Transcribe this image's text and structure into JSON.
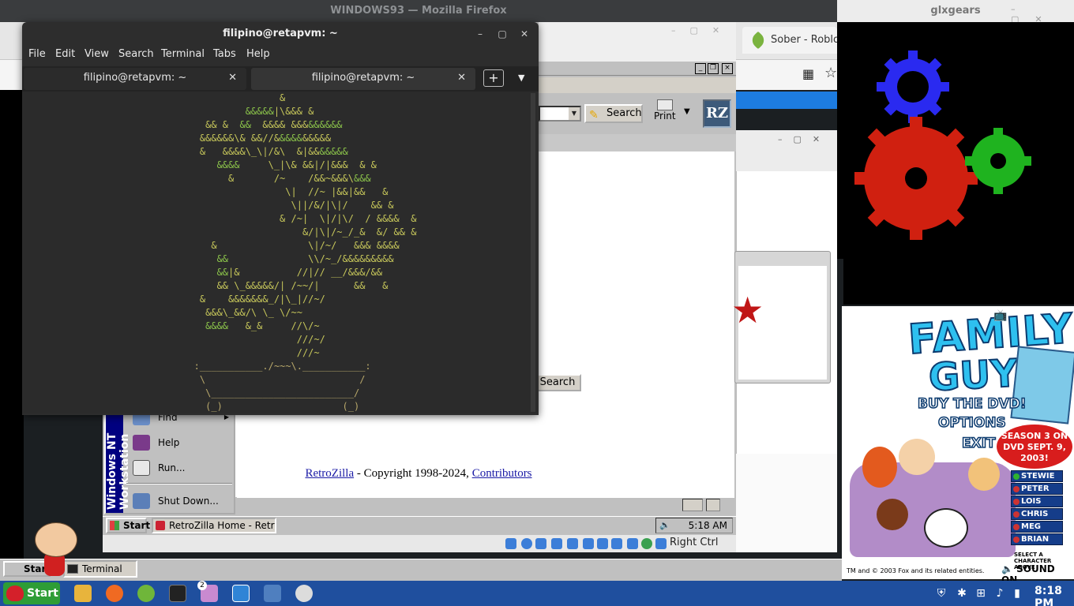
{
  "firefox": {
    "title": "WINDOWS93 — Mozilla Firefox",
    "tab_right_label": "Sober - Roblo"
  },
  "retrozilla": {
    "search_button": "Search",
    "print_label": "Print",
    "logo_text": "RZ",
    "content_search_button": "Search",
    "footer_link": "RetroZilla",
    "footer_text": " - Copyright 1998-2024, ",
    "footer_contributors": "Contributors"
  },
  "nt": {
    "banner": "Windows NT Workstation",
    "start_menu": [
      {
        "label": "Find",
        "icon": "find-icon"
      },
      {
        "label": "Help",
        "icon": "help-icon"
      },
      {
        "label": "Run...",
        "icon": "run-icon"
      },
      {
        "label": "Shut Down...",
        "icon": "shutdown-icon"
      }
    ],
    "start": "Start",
    "task": "RetroZilla Home - RetroZilla",
    "clock": "5:18 AM"
  },
  "vbox": {
    "host_key": "Right Ctrl"
  },
  "terminal": {
    "title": "filipino@retapvm: ~",
    "menu": [
      "File",
      "Edit",
      "View",
      "Search",
      "Terminal",
      "Tabs",
      "Help"
    ],
    "tabs": [
      "filipino@retapvm: ~",
      "filipino@retapvm: ~"
    ]
  },
  "glxgears": {
    "title": "glxgears"
  },
  "family_guy": {
    "title_line1": "FAMILY",
    "title_line2": "GUY",
    "menu": [
      "BUY THE DVD!",
      "OPTIONS",
      "EXIT"
    ],
    "season": "SEASON 3 ON DVD SEPT. 9, 2003!",
    "characters": [
      "STEWIE",
      "PETER",
      "LOIS",
      "CHRIS",
      "MEG",
      "BRIAN"
    ],
    "select_prompt": "SELECT A CHARACTER ABOVE",
    "copyright": "TM and © 2003 Fox and its related entities.",
    "sound": "SOUND ON"
  },
  "inner_taskbar": {
    "start": "Start",
    "task": "Terminal"
  },
  "host_panel": {
    "start": "Start",
    "badge_count": "2",
    "clock": "8:18 PM"
  },
  "colors": {
    "host_panel": "#1f4f9e",
    "terminal_bg": "#2b2b2b",
    "nt_grey": "#c0c0c0"
  }
}
